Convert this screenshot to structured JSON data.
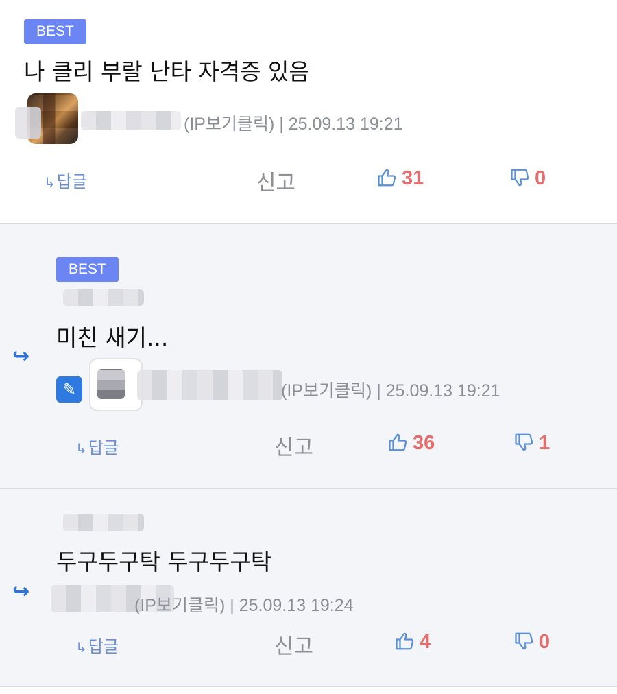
{
  "comments": [
    {
      "badge": "BEST",
      "text": "나 클리 부랄 난타 자격증 있음",
      "ip_label": "(IP보기클릭)",
      "datetime": "25.09.13 19:21",
      "reply_label": "답글",
      "report_label": "신고",
      "likes": "31",
      "dislikes": "0"
    },
    {
      "badge": "BEST",
      "text": "미친 새기...",
      "ip_label": "(IP보기클릭)",
      "datetime": "25.09.13 19:21",
      "reply_label": "답글",
      "report_label": "신고",
      "likes": "36",
      "dislikes": "1"
    },
    {
      "text": "두구두구탁 두구두구탁",
      "ip_label": "(IP보기클릭)",
      "datetime": "25.09.13 19:24",
      "reply_label": "답글",
      "report_label": "신고",
      "likes": "4",
      "dislikes": "0"
    }
  ],
  "icons": {
    "reply_arrow": "reply-arrow-icon",
    "thumbs_up": "thumbs-up-icon",
    "thumbs_down": "thumbs-down-icon",
    "pen": "pen-icon"
  },
  "colors": {
    "badge": "#6b86f2",
    "vote_count": "#e76d6d",
    "icon_blue": "#5a8fd8",
    "meta": "#8b8e96"
  }
}
